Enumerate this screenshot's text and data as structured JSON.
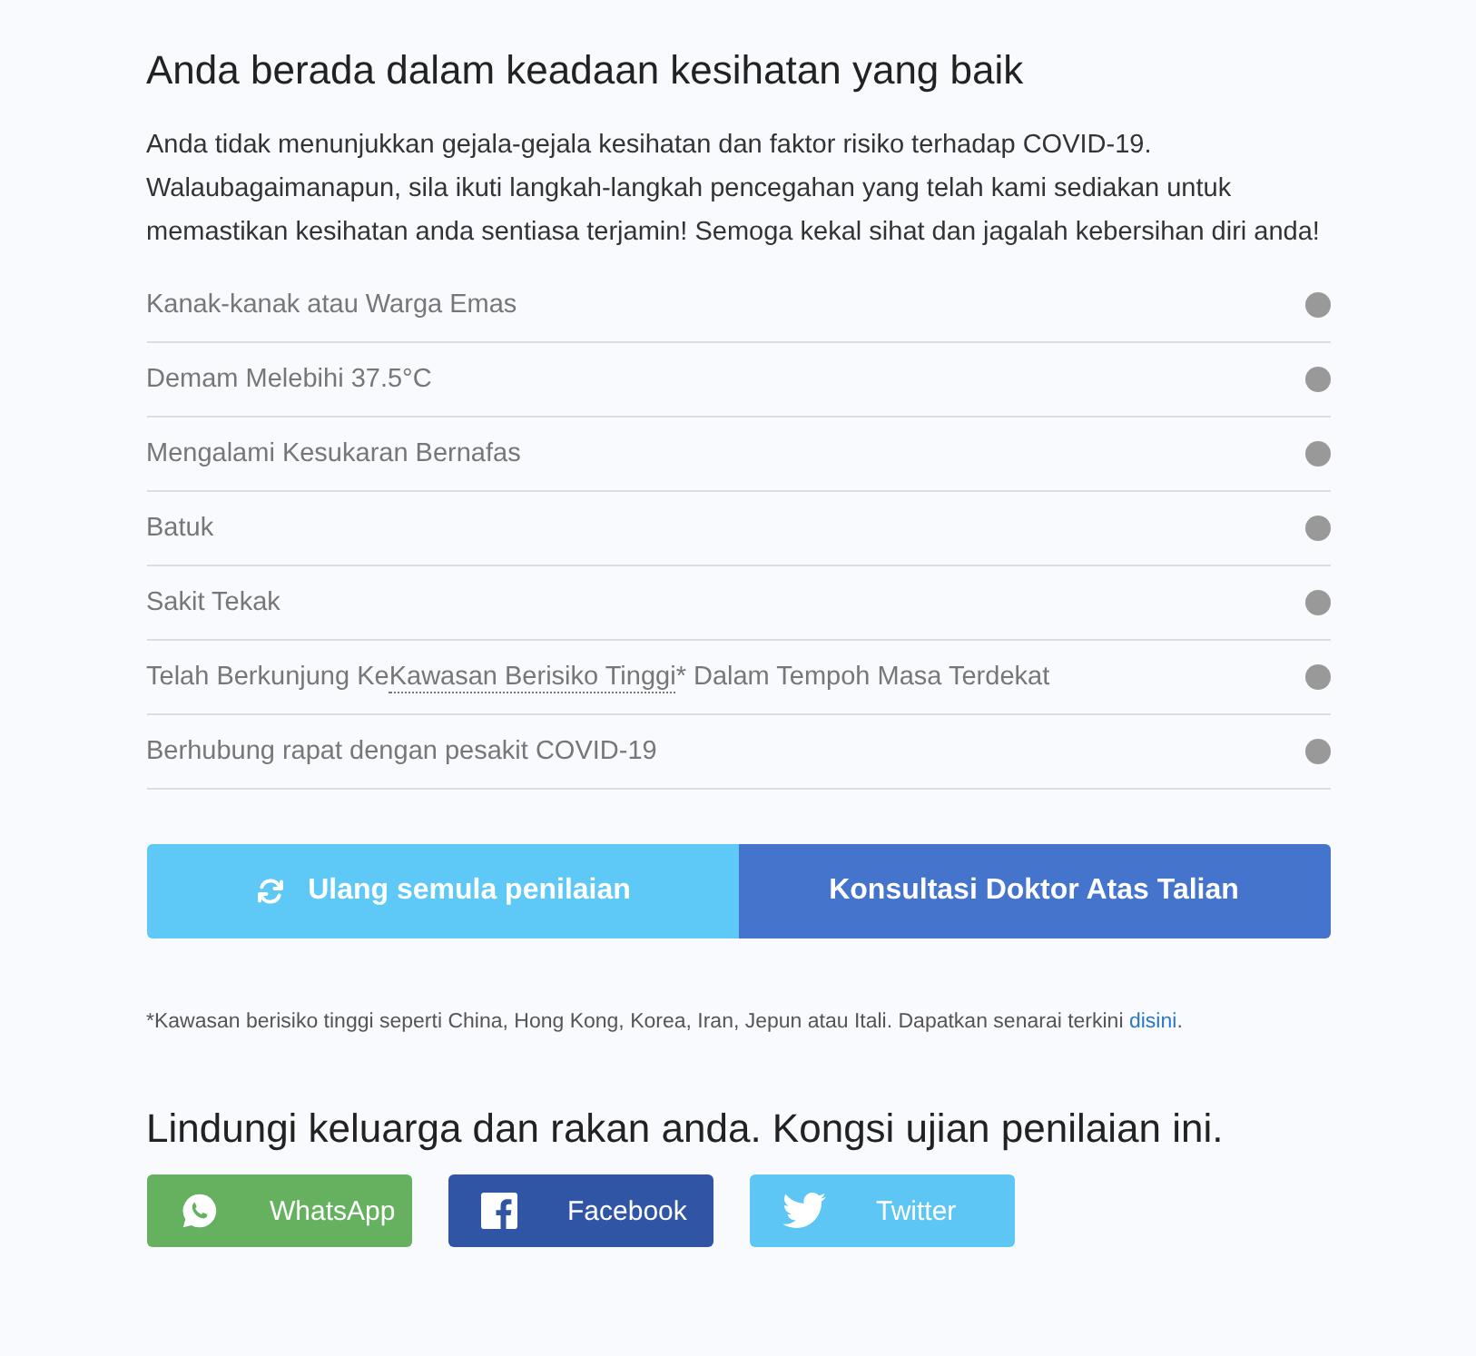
{
  "result": {
    "title": "Anda berada dalam keadaan kesihatan yang baik",
    "description": "Anda tidak menunjukkan gejala-gejala kesihatan dan faktor risiko terhadap COVID-19. Walaubagaimanapun, sila ikuti langkah-langkah pencegahan yang telah kami sediakan untuk memastikan kesihatan anda sentiasa terjamin! Semoga kekal sihat dan jagalah kebersihan diri anda!"
  },
  "symptoms": [
    {
      "label": "Kanak-kanak atau Warga Emas"
    },
    {
      "label": "Demam Melebihi 37.5°C"
    },
    {
      "label": "Mengalami Kesukaran Bernafas"
    },
    {
      "label": "Batuk"
    },
    {
      "label": "Sakit Tekak"
    },
    {
      "label": "Telah Berkunjung Ke",
      "term": "Kawasan Berisiko Tinggi",
      "after": "* Dalam Tempoh Masa Terdekat"
    },
    {
      "label": "Berhubung rapat dengan pesakit COVID-19"
    }
  ],
  "actions": [
    {
      "kind": "reset",
      "label": "Ulang semula penilaian"
    },
    {
      "kind": "consult",
      "label": "Konsultasi Doktor Atas Talian"
    }
  ],
  "footnote": {
    "text": "*Kawasan berisiko tinggi seperti China, Hong Kong, Korea, Iran, Jepun atau Itali. Dapatkan senarai terkini ",
    "link": "disini",
    "end": "."
  },
  "share": {
    "title": "Lindungi keluarga dan rakan anda. Kongsi ujian penilaian ini.",
    "buttons": [
      {
        "kind": "whatsapp",
        "label": "WhatsApp"
      },
      {
        "kind": "facebook",
        "label": "Facebook"
      },
      {
        "kind": "twitter",
        "label": "Twitter"
      }
    ]
  }
}
